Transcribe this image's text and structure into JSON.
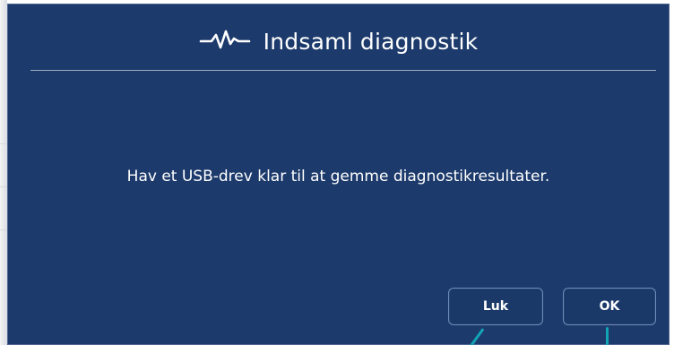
{
  "dialog": {
    "title": "Indsaml diagnostik",
    "title_icon": "pulse-icon",
    "message": "Hav et USB-drev klar til at gemme diagnostikresultater.",
    "buttons": {
      "close_label": "Luk",
      "ok_label": "OK"
    },
    "colors": {
      "background": "#1c3a6b",
      "text": "#ffffff",
      "divider": "#a7b1c6",
      "button_border": "#6f89b8",
      "callout": "#13a4b5"
    }
  }
}
